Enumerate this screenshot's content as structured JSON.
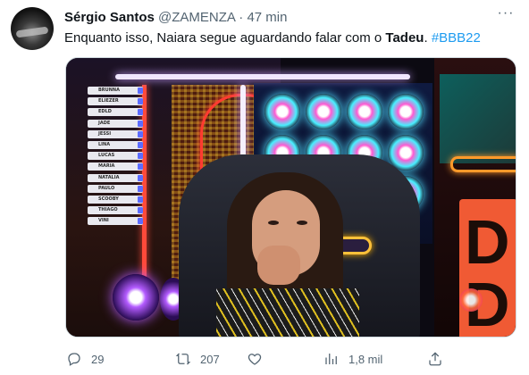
{
  "tweet": {
    "author_name": "Sérgio Santos",
    "author_handle": "@ZAMENZA",
    "separator": "·",
    "time": "47 min",
    "text_before": "Enquanto isso, Naiara segue aguardando falar com o ",
    "text_bold": "Tadeu",
    "text_after": ". ",
    "hashtag": "#BBB22"
  },
  "media": {
    "nameplates": [
      "BRUNNA",
      "ELIEZER",
      "EDLD",
      "JADE",
      "JESSI",
      "LINA",
      "LUCAS",
      "MARIA",
      "NATALIA",
      "PAULO",
      "SCOOBY",
      "THIAGO",
      "VINI"
    ],
    "big_letter": "D"
  },
  "actions": {
    "reply_count": "29",
    "retweet_count": "207",
    "views_count": "1,8 mil"
  },
  "colors": {
    "accent": "#1d9bf0",
    "muted": "#536471"
  }
}
